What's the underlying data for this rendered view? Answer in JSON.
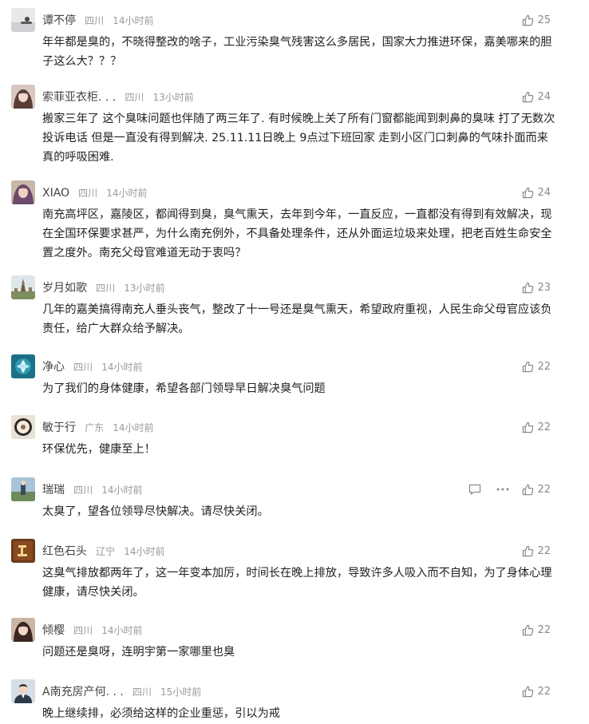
{
  "comments": [
    {
      "username": "谭不停",
      "location": "四川",
      "time": "14小时前",
      "likes": "25",
      "content": "年年都是臭的，不晓得整改的啥子，工业污染臭气残害这么多居民，国家大力推进环保，嘉美哪来的胆子这么大？？？"
    },
    {
      "username": "索菲亚衣柜. . .",
      "location": "四川",
      "time": "13小时前",
      "likes": "24",
      "content": "搬家三年了 这个臭味问题也伴随了两三年了. 有时候晚上关了所有门窗都能闻到刺鼻的臭味 打了无数次投诉电话 但是一直没有得到解决. 25.11.11日晚上 9点过下班回家 走到小区门口刺鼻的气味扑面而来 真的呼吸困难."
    },
    {
      "username": "XIAO",
      "location": "四川",
      "time": "14小时前",
      "likes": "24",
      "content": "南充高坪区，嘉陵区，都闻得到臭，臭气熏天，去年到今年，一直反应，一直都没有得到有效解决，现在全国环保要求甚严，为什么南充例外，不具备处理条件，还从外面运垃圾来处理，把老百姓生命安全置之度外。南充父母官难道无动于衷吗？"
    },
    {
      "username": "岁月如歌",
      "location": "四川",
      "time": "13小时前",
      "likes": "23",
      "content": "几年的嘉美搞得南充人垂头丧气，整改了十一号还是臭气熏天，希望政府重视，人民生命父母官应该负责任，给广大群众给予解决。"
    },
    {
      "username": "净心",
      "location": "四川",
      "time": "14小时前",
      "likes": "22",
      "content": "为了我们的身体健康，希望各部门领导早日解决臭气问题"
    },
    {
      "username": "敏于行",
      "location": "广东",
      "time": "14小时前",
      "likes": "22",
      "content": "环保优先，健康至上！"
    },
    {
      "username": "瑞瑞",
      "location": "四川",
      "time": "14小时前",
      "likes": "22",
      "content": "太臭了，望各位领导尽快解决。请尽快关闭。"
    },
    {
      "username": "红色石头",
      "location": "辽宁",
      "time": "14小时前",
      "likes": "22",
      "content": "这臭气排放都两年了，这一年变本加厉，时间长在晚上排放，导致许多人吸入而不自知，为了身体心理健康，请尽快关闭。"
    },
    {
      "username": "倾樱",
      "location": "四川",
      "time": "14小时前",
      "likes": "22",
      "content": "问题还是臭呀，连明宇第一家哪里也臭"
    },
    {
      "username": "A南充房产何. . .",
      "location": "四川",
      "time": "15小时前",
      "likes": "22",
      "content": "晚上继续排，必须给这样的企业重惩，引以为戒"
    }
  ],
  "icons": {
    "like": "thumbs-up-icon",
    "reply": "reply-bubble-icon",
    "more": "more-dots-icon"
  },
  "colors": {
    "username": "#444444",
    "meta": "#9a9a9a",
    "text": "#222222",
    "icon": "#8a8a8a"
  }
}
